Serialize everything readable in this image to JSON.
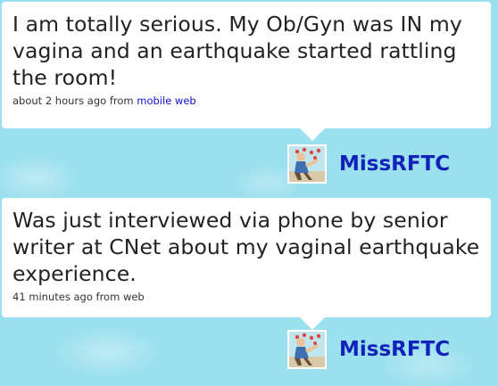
{
  "tweets": [
    {
      "text": "I am totally serious. My Ob/Gyn was IN my vagina and an earthquake started rattling the room!",
      "time": "about 2 hours ago from",
      "source": "mobile web",
      "username": "MissRFTC"
    },
    {
      "text": "Was just interviewed via phone by senior writer at CNet about my vaginal earthquake experience.",
      "time": "41 minutes ago from web",
      "username": "MissRFTC"
    }
  ],
  "colors": {
    "background": "#9be0ee",
    "username": "#1122bb",
    "source_link": "#1111cc"
  },
  "icons": {
    "avatar": "user-avatar-image"
  }
}
